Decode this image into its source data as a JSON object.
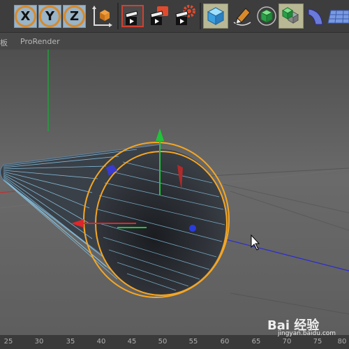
{
  "toolbar": {
    "axis_x_label": "X",
    "axis_y_label": "Y",
    "axis_z_label": "Z"
  },
  "menubar": {
    "panel_label": "面板",
    "prorender_label": "ProRender"
  },
  "ruler": {
    "ticks": [
      "25",
      "30",
      "35",
      "40",
      "45",
      "50",
      "55",
      "60",
      "65",
      "70",
      "75",
      "80"
    ]
  },
  "watermark": {
    "brand": "Bai 经验",
    "url": "jingyan.baidu.com"
  },
  "colors": {
    "selection_orange": "#f5a623",
    "axis_x": "#e0262a",
    "axis_y": "#22c23a",
    "axis_z": "#2a3cd8",
    "wireframe": "#8fd0f0"
  }
}
